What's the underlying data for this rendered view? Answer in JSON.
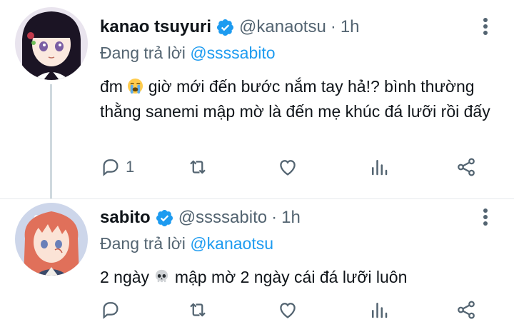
{
  "tweets": [
    {
      "display_name": "kanao tsuyuri",
      "handle": "@kanaotsu",
      "separator": "·",
      "time": "1h",
      "reply_prefix": "Đang trả lời",
      "reply_to": "@ssssabito",
      "text_before_emoji": "đm",
      "emoji": "crying-face",
      "text_after_emoji": "giờ mới đến bước nắm tay hả!? bình thường thằng sanemi mập mờ là đến mẹ khúc đá lưỡi rồi đấy",
      "reply_count": "1",
      "avatar": "kanao-avatar"
    },
    {
      "display_name": "sabito",
      "handle": "@ssssabito",
      "separator": "·",
      "time": "1h",
      "reply_prefix": "Đang trả lời",
      "reply_to": "@kanaotsu",
      "text_before_emoji": "2 ngày",
      "emoji": "skull",
      "text_after_emoji": "mập mờ 2 ngày cái đá lưỡi luôn",
      "reply_count": "",
      "avatar": "sabito-avatar"
    }
  ],
  "icons": {
    "verified": "verified-badge-icon",
    "menu": "more-vertical-icon",
    "reply": "reply-icon",
    "retweet": "retweet-icon",
    "like": "heart-icon",
    "stats": "analytics-icon",
    "share": "share-icon"
  },
  "colors": {
    "link": "#1d9bf0",
    "secondary_text": "#536471",
    "primary_text": "#0f1419",
    "verified": "#1d9bf0"
  }
}
